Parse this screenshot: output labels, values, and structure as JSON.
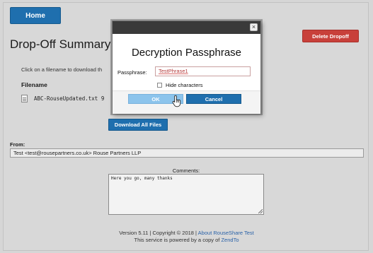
{
  "nav": {
    "home_label": "Home"
  },
  "actions": {
    "delete_label": "Delete Dropoff",
    "download_all_label": "Download All Files"
  },
  "summary": {
    "title": "Drop-Off Summary",
    "instruction": "Click on a filename to download th",
    "filename_header": "Filename",
    "files": [
      {
        "name": "ABC-RouseUpdated.txt 9"
      }
    ]
  },
  "from": {
    "label": "From:",
    "value": "Test <test@rousepartners.co.uk> Rouse Partners LLP"
  },
  "comments": {
    "label": "Comments:",
    "text": "Here you go, many thanks"
  },
  "footer": {
    "version_text": "Version 5.11 | Copyright © 2018 |",
    "about_link": "About RouseShare Test",
    "powered_text": "This service is powered by a copy of",
    "zendto_link": "ZendTo"
  },
  "modal": {
    "close_glyph": "×",
    "title": "Decryption Passphrase",
    "passphrase_label": "Passphrase:",
    "passphrase_value": "TestPhrase1",
    "hide_characters_label": "Hide characters",
    "hide_characters_checked": false,
    "ok_label": "OK",
    "cancel_label": "Cancel"
  },
  "colors": {
    "primary_button": "#1f6fae",
    "danger_button": "#c8403a",
    "ok_button_hover": "#8cc4ec",
    "link": "#2a62a8"
  },
  "icons": [
    "file-icon",
    "close-icon",
    "hand-cursor-icon"
  ]
}
